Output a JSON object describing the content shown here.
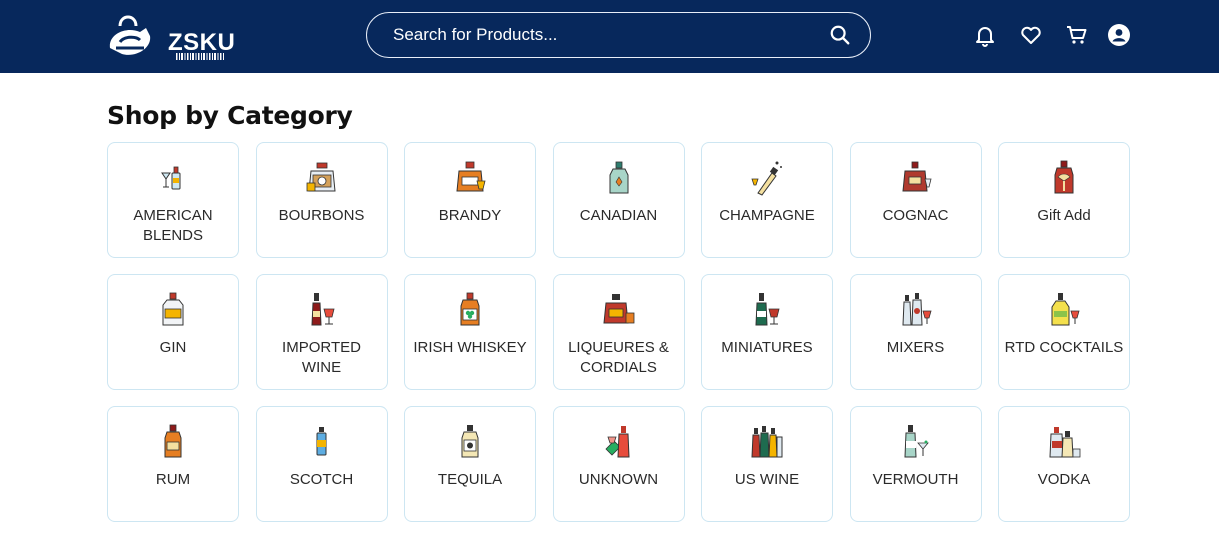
{
  "header": {
    "logo_text": "ZSKU",
    "search_placeholder": "Search for Products...",
    "icons": [
      "bell-icon",
      "heart-icon",
      "cart-icon",
      "user-icon"
    ]
  },
  "section": {
    "title": "Shop by Category"
  },
  "categories": [
    {
      "label": "AMERICAN BLENDS",
      "icon": "cocktail-bottle-icon"
    },
    {
      "label": "BOURBONS",
      "icon": "bourbon-bottle-icon"
    },
    {
      "label": "BRANDY",
      "icon": "brandy-bottle-icon"
    },
    {
      "label": "CANADIAN",
      "icon": "maple-bottle-icon"
    },
    {
      "label": "CHAMPAGNE",
      "icon": "champagne-bottle-icon"
    },
    {
      "label": "COGNAC",
      "icon": "cognac-bottle-icon"
    },
    {
      "label": "Gift Add",
      "icon": "gift-bottle-icon"
    },
    {
      "label": "GIN",
      "icon": "gin-bottle-icon"
    },
    {
      "label": "IMPORTED WINE",
      "icon": "wine-bottle-icon"
    },
    {
      "label": "IRISH WHISKEY",
      "icon": "clover-bottle-icon"
    },
    {
      "label": "LIQUEURES & CORDIALS",
      "icon": "liqueur-bottle-icon"
    },
    {
      "label": "MINIATURES",
      "icon": "mini-bottle-icon"
    },
    {
      "label": "MIXERS",
      "icon": "mixer-bottles-icon"
    },
    {
      "label": "RTD COCKTAILS",
      "icon": "rtd-bottle-icon"
    },
    {
      "label": "RUM",
      "icon": "rum-bottle-icon"
    },
    {
      "label": "SCOTCH",
      "icon": "scotch-bottle-icon"
    },
    {
      "label": "TEQUILA",
      "icon": "tequila-bottle-icon"
    },
    {
      "label": "UNKNOWN",
      "icon": "unknown-bottle-icon"
    },
    {
      "label": "US WINE",
      "icon": "us-wine-bottles-icon"
    },
    {
      "label": "VERMOUTH",
      "icon": "vermouth-bottle-icon"
    },
    {
      "label": "VODKA",
      "icon": "vodka-bottles-icon"
    }
  ],
  "colors": {
    "header_bg": "#07285c",
    "card_border": "#cde6f2"
  }
}
